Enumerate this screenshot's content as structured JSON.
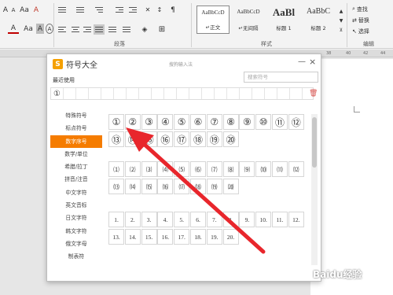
{
  "ribbon": {
    "font_row1": [
      "A",
      "A",
      "Aa",
      "A"
    ],
    "font_row2": [
      "A",
      "Aa",
      "A",
      "A"
    ],
    "group_paragraph": "段落",
    "group_styles": "样式",
    "group_editing": "编辑",
    "styles": [
      {
        "preview": "AaBbCcD",
        "name": "↵正文"
      },
      {
        "preview": "AaBbCcD",
        "name": "↵无间隔"
      },
      {
        "preview": "AaBl",
        "name": "标题 1"
      },
      {
        "preview": "AaBbC",
        "name": "标题 2"
      }
    ],
    "edit": {
      "find": "查找",
      "replace": "替换",
      "select": "选择"
    },
    "ruler_marks": [
      "38",
      "40",
      "42",
      "44"
    ]
  },
  "dialog": {
    "title": "符号大全",
    "subtitle": "搜狗输入法",
    "minimize": "—",
    "close": "×",
    "recent_label": "最近使用",
    "search_placeholder": "搜索符号",
    "recent": [
      "①",
      "",
      "",
      "",
      "",
      "",
      "",
      "",
      "",
      "",
      "",
      "",
      "",
      "",
      "",
      "",
      "",
      "",
      "",
      ""
    ],
    "trash": "🗑",
    "categories": [
      "特殊符号",
      "标点符号",
      "数字序号",
      "数学/单位",
      "希腊/拉丁",
      "拼音/注音",
      "中文字符",
      "英文音标",
      "日文字符",
      "韩文字符",
      "俄文字母",
      "制表符"
    ],
    "active_category": "数字序号",
    "circled": [
      "①",
      "②",
      "③",
      "④",
      "⑤",
      "⑥",
      "⑦",
      "⑧",
      "⑨",
      "⑩",
      "⑪",
      "⑫",
      "⑬",
      "⑭",
      "⑮",
      "⑯",
      "⑰",
      "⑱",
      "⑲",
      "⑳"
    ],
    "parenthesized": [
      "⑴",
      "⑵",
      "⑶",
      "⑷",
      "⑸",
      "⑹",
      "⑺",
      "⑻",
      "⑼",
      "⑽",
      "⑾",
      "⑿",
      "⒀",
      "⒁",
      "⒂",
      "⒃",
      "⒄",
      "⒅",
      "⒆",
      "⒇"
    ],
    "dotted": [
      "1.",
      "2.",
      "3.",
      "4.",
      "5.",
      "6.",
      "7.",
      "8.",
      "9.",
      "10.",
      "11.",
      "12.",
      "13.",
      "14.",
      "15.",
      "16.",
      "17.",
      "18.",
      "19.",
      "20."
    ]
  },
  "watermark": "Baidu经验",
  "colors": {
    "accent": "#f57c00",
    "arrow": "#e8262c"
  }
}
